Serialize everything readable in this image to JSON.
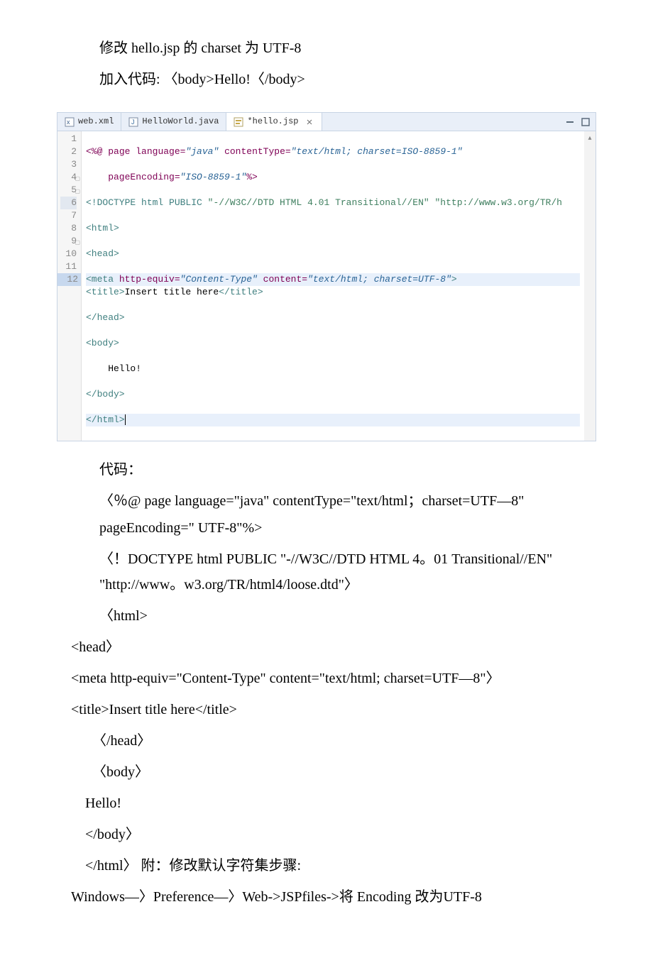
{
  "body_text": {
    "p1": "修改 hello.jsp 的 charset 为 UTF-8",
    "p2": "加入代码: 〈body>Hello!〈/body>",
    "p3": "代码：",
    "p4a": "〈％@ page language=\"java\" contentType=\"text/html；charset=UTF—8\"",
    "p4b": "　pageEncoding=\" UTF-8\"%>",
    "p5a": "〈！DOCTYPE html PUBLIC \"-//W3C//DTD HTML 4。01 Transitional//EN\" \"http://www。w3.org/TR/html4/loose.dtd\"〉",
    "p6": "〈html>",
    "p7": "<head〉",
    "p8": "<meta http-equiv=\"Content-Type\" content=\"text/html; charset=UTF—8\"〉",
    "p9": "<title>Insert title here</title>",
    "p10": "〈/head〉",
    "p11": "〈body〉",
    "p12": " Hello!",
    "p13": "</body〉",
    "p14": "</html〉 附：修改默认字符集步骤:",
    "p15": "Windows—〉Preference—〉Web->JSPfiles->将 Encoding 改为UTF-8"
  },
  "tabs": {
    "t1": "web.xml",
    "t2": "HelloWorld.java",
    "t3": "*hello.jsp"
  },
  "gutter": [
    "1",
    "2",
    "3",
    "4",
    "5",
    "6",
    "7",
    "8",
    "9",
    "10",
    "11",
    "12"
  ],
  "code": {
    "l1a": "<%@ ",
    "l1b": "page ",
    "l1c": "language=",
    "l1d": "\"java\"",
    "l1e": " contentType=",
    "l1f": "\"text/html; charset=ISO-8859-1\"",
    "l2a": "    pageEncoding=",
    "l2b": "\"ISO-8859-1\"",
    "l2c": "%>",
    "l3a": "<!DOCTYPE ",
    "l3b": "html ",
    "l3c": "PUBLIC ",
    "l3d": "\"-//W3C//DTD HTML 4.01 Transitional//EN\"",
    "l3e": " \"http://www.w3.org/TR/h",
    "l4a": "<html>",
    "l5a": "<head>",
    "l6a": "<meta ",
    "l6b": "http-equiv=",
    "l6c": "\"Content-Type\"",
    "l6d": " content=",
    "l6e": "\"text/html; charset=UTF-8\"",
    "l6f": ">",
    "l7a": "<title>",
    "l7b": "Insert title here",
    "l7c": "</title>",
    "l8a": "</head>",
    "l9a": "<body>",
    "l10a": "    Hello!",
    "l11a": "</body>",
    "l12a": "</html>"
  }
}
